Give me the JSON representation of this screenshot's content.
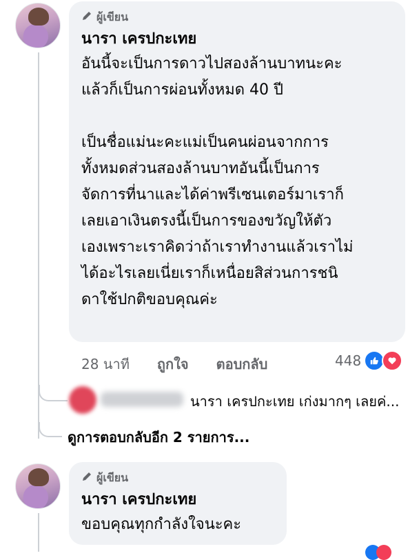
{
  "comment1": {
    "author_badge": "ผู้เขียน",
    "author_name": "นารา เครปกะเทย",
    "text": "อันนี้จะเป็นการดาวไปสองล้านบาทนะคะ\nแล้วก็เป็นการผ่อนทั้งหมด 40 ปี\n\nเป็นชื่อแม่นะคะแม่เป็นคนผ่อนจากการ\nทั้งหมดส่วนสองล้านบาทอันนี้เป็นการ\nจัดการที่นาและได้ค่าพรีเซนเตอร์มาเราก็\nเลยเอาเงินตรงนี้เป็นการของขวัญให้ตัว\nเองเพราะเราคิดว่าถ้าเราทำงานแล้วเราไม่\nได้อะไรเลยเนี่ยเราก็เหนื่อยสิส่วนการชนิ\nดาใช้ปกติขอบคุณค่ะ",
    "time": "28 นาที",
    "like_label": "ถูกใจ",
    "reply_label": "ตอบกลับ",
    "reaction_count": "448",
    "reactions": [
      "like-icon",
      "love-icon"
    ]
  },
  "reply_preview": {
    "text": "นารา เครปกะเทย เก่งมากๆ เลยค่..."
  },
  "more_replies": {
    "label": "ดูการตอบกลับอีก 2 รายการ..."
  },
  "comment2": {
    "author_badge": "ผู้เขียน",
    "author_name": "นารา เครปกะเทย",
    "text": "ขอบคุณทุกกำลังใจนะคะ"
  },
  "colors": {
    "bubble_bg": "#f0f2f5",
    "secondary_text": "#65676b",
    "like_blue": "#1877f2",
    "love_red": "#f33e58"
  }
}
